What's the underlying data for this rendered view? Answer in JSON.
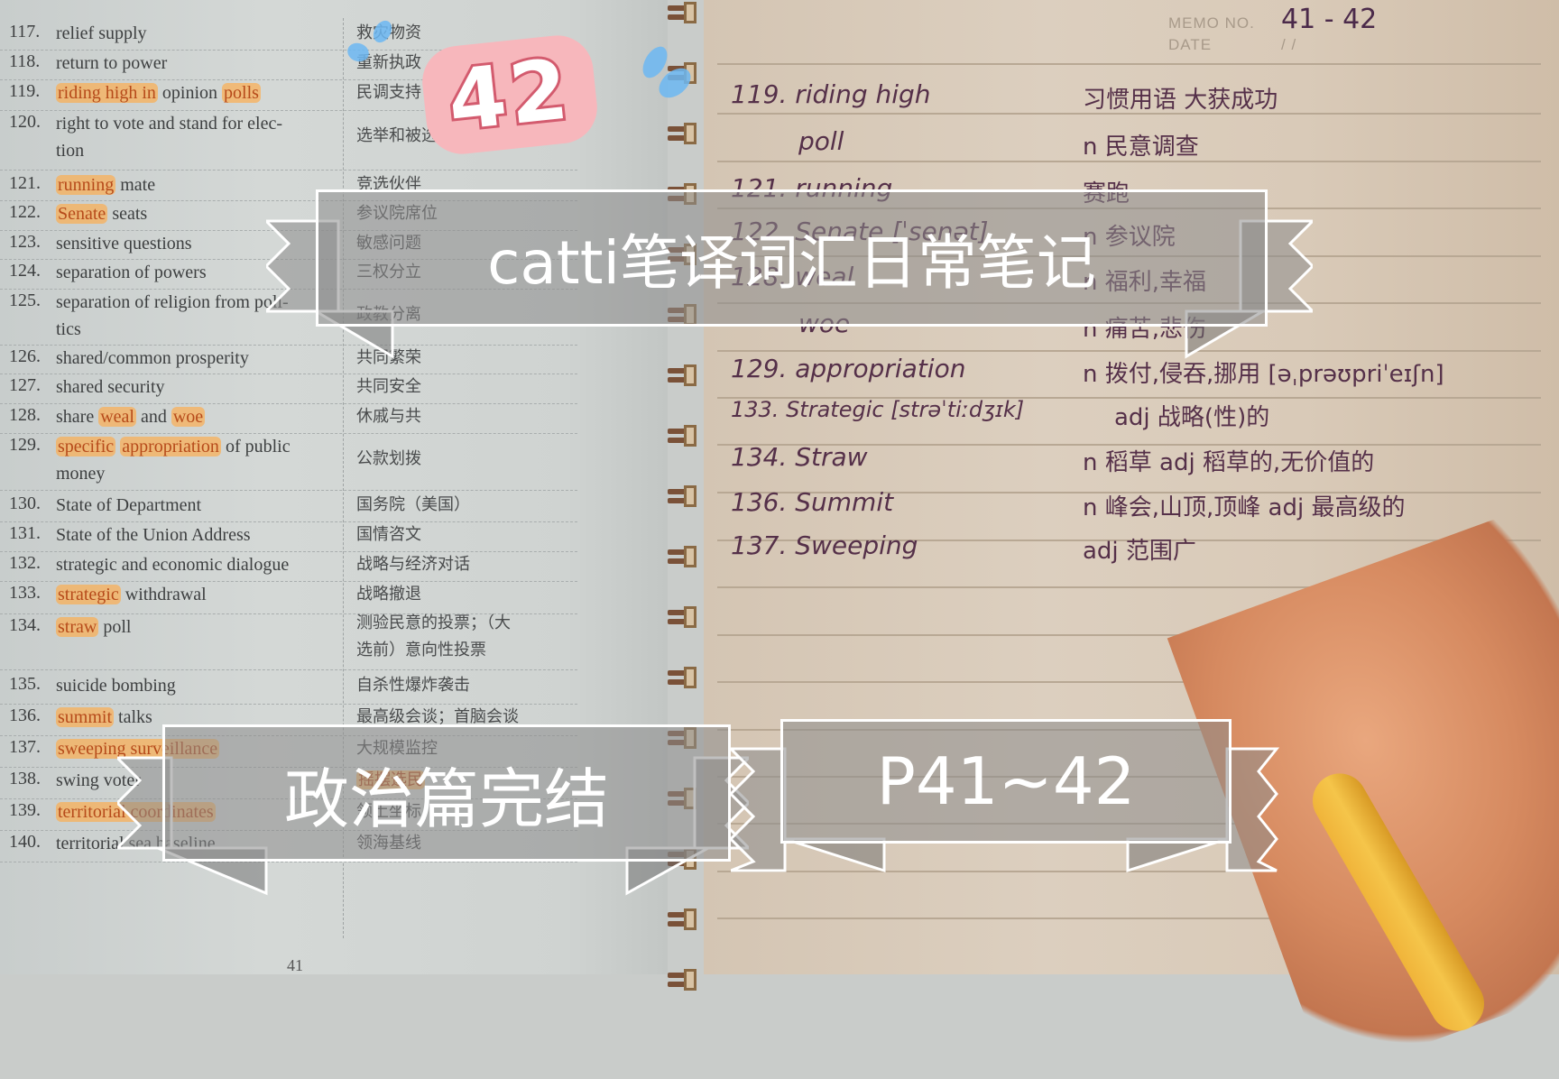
{
  "book_page": {
    "page_number": "41",
    "entries": [
      {
        "num": "117.",
        "en": "relief supply",
        "zh": "救灾物资",
        "highlight": []
      },
      {
        "num": "118.",
        "en": "return to power",
        "zh": "重新执政",
        "highlight": []
      },
      {
        "num": "119.",
        "en": "riding high in opinion polls",
        "zh": "民调支持",
        "highlight": [
          "riding high in",
          "polls"
        ]
      },
      {
        "num": "120.",
        "en": "right to vote and stand for elec-",
        "en2": "tion",
        "zh": "选举和被选举权",
        "highlight": []
      },
      {
        "num": "121.",
        "en": "running mate",
        "zh": "竞选伙伴",
        "highlight": [
          "running"
        ]
      },
      {
        "num": "122.",
        "en": "Senate seats",
        "zh": "参议院席位",
        "highlight": [
          "Senate"
        ]
      },
      {
        "num": "123.",
        "en": "sensitive questions",
        "zh": "敏感问题",
        "highlight": []
      },
      {
        "num": "124.",
        "en": "separation of powers",
        "zh": "三权分立",
        "highlight": []
      },
      {
        "num": "125.",
        "en": "separation of religion from poli-",
        "en2": "tics",
        "zh": "政教分离",
        "highlight": []
      },
      {
        "num": "126.",
        "en": "shared/common prosperity",
        "zh": "共同繁荣",
        "highlight": []
      },
      {
        "num": "127.",
        "en": "shared security",
        "zh": "共同安全",
        "highlight": []
      },
      {
        "num": "128.",
        "en": "share weal and woe",
        "zh": "休戚与共",
        "highlight": [
          "weal",
          "woe"
        ]
      },
      {
        "num": "129.",
        "en": "specific appropriation of public",
        "en2": "money",
        "zh": "公款划拨",
        "highlight": [
          "specific",
          "appropriation"
        ]
      },
      {
        "num": "130.",
        "en": "State of Department",
        "zh": "国务院（美国）",
        "highlight": []
      },
      {
        "num": "131.",
        "en": "State of the Union Address",
        "zh": "国情咨文",
        "highlight": []
      },
      {
        "num": "132.",
        "en": "strategic and economic dialogue",
        "zh": "战略与经济对话",
        "highlight": []
      },
      {
        "num": "133.",
        "en": "strategic withdrawal",
        "zh": "战略撤退",
        "highlight": [
          "strategic"
        ]
      },
      {
        "num": "134.",
        "en": "straw poll",
        "zh": "测验民意的投票；（大",
        "zh2": "选前）意向性投票",
        "highlight": [
          "straw"
        ]
      },
      {
        "num": "135.",
        "en": "suicide bombing",
        "zh": "自杀性爆炸袭击",
        "highlight": []
      },
      {
        "num": "136.",
        "en": "summit talks",
        "zh": "最高级会谈；首脑会谈",
        "highlight": [
          "summit"
        ]
      },
      {
        "num": "137.",
        "en": "sweeping surveillance",
        "zh": "大规模监控",
        "highlight": [
          "sweeping surveillance"
        ]
      },
      {
        "num": "138.",
        "en": "swing voter",
        "zh": "摇摆选民",
        "highlight": []
      },
      {
        "num": "139.",
        "en": "territorial coordinates",
        "zh": "领土坐标",
        "highlight": [
          "territorial coordinates"
        ]
      },
      {
        "num": "140.",
        "en": "territorial sea baseline",
        "zh": "领海基线",
        "highlight": []
      }
    ]
  },
  "notebook": {
    "memo_label": "MEMO NO.",
    "memo_value": "41 - 42",
    "date_label": "DATE",
    "date_value": "/   /",
    "notes": [
      {
        "term": "119. riding high",
        "meaning": "习惯用语     大获成功"
      },
      {
        "term": "poll",
        "meaning": "n 民意调查"
      },
      {
        "term": "121. running",
        "meaning": "赛跑"
      },
      {
        "term": "122. Senate [ˈsenət]",
        "meaning": "n 参议院"
      },
      {
        "term": "128. weal",
        "meaning": "n 福利,幸福"
      },
      {
        "term": "woe",
        "meaning": "n 痛苦,悲伤"
      },
      {
        "term": "129. appropriation",
        "meaning": "n 拨付,侵吞,挪用 [əˌprəʊpriˈeɪʃn]"
      },
      {
        "term": "133. Strategic [strəˈtiːdʒɪk]",
        "meaning": "adj 战略(性)的"
      },
      {
        "term": "134. Straw",
        "meaning": "n 稻草  adj 稻草的,无价值的"
      },
      {
        "term": "136. Summit",
        "meaning": "n 峰会,山顶,顶峰  adj 最高级的"
      },
      {
        "term": "137. Sweeping",
        "meaning": "adj 范围广"
      }
    ]
  },
  "overlays": {
    "sticker_number": "42",
    "title_banner": "catti笔译词汇日常笔记",
    "section_banner": "政治篇完结",
    "pages_banner": "P41~42"
  }
}
